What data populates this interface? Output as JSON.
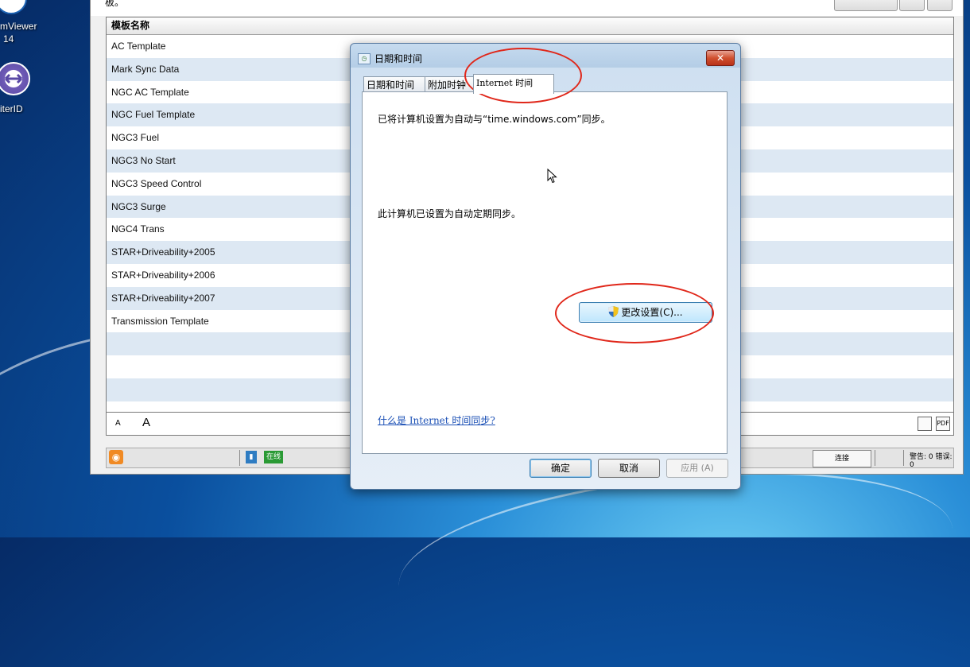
{
  "desktop": {
    "icons": [
      {
        "label_line1": "mViewer",
        "label_line2": "14"
      },
      {
        "label_line1": "iterID"
      }
    ]
  },
  "app": {
    "intro_text": "板。",
    "toolbar": {
      "import_button": "",
      "small_button": ""
    },
    "list": {
      "header": "模板名称",
      "rows": [
        "AC Template",
        "Mark Sync Data",
        "NGC AC Template",
        "NGC Fuel Template",
        "NGC3 Fuel",
        "NGC3 No Start",
        "NGC3 Speed Control",
        "NGC3 Surge",
        "NGC4 Trans",
        "STAR+Driveability+2005",
        "STAR+Driveability+2006",
        "STAR+Driveability+2007",
        "Transmission Template",
        "",
        "",
        "",
        ""
      ]
    },
    "font_bar": {
      "small": "A",
      "large": "A",
      "print_icon_text": "",
      "pdf_icon_text": "PDF"
    },
    "status": {
      "online": "在线",
      "connect": "连接",
      "counts": "警告: 0 错误: 0"
    }
  },
  "dialog": {
    "title": "日期和时间",
    "close_symbol": "✕",
    "tabs": [
      {
        "label": "日期和时间",
        "active": false
      },
      {
        "label": "附加时钟",
        "active": false
      },
      {
        "label": "Internet 时间",
        "active": true
      }
    ],
    "sync_text": "已将计算机设置为自动与“time.windows.com”同步。",
    "auto_text": "此计算机已设置为自动定期同步。",
    "change_button": "更改设置(C)...",
    "help_link": "什么是 Internet 时间同步?",
    "ok_button": "确定",
    "cancel_button": "取消",
    "apply_button": "应用 (A)"
  },
  "colors": {
    "annotation": "#e0271a",
    "link": "#1a4fb5"
  }
}
